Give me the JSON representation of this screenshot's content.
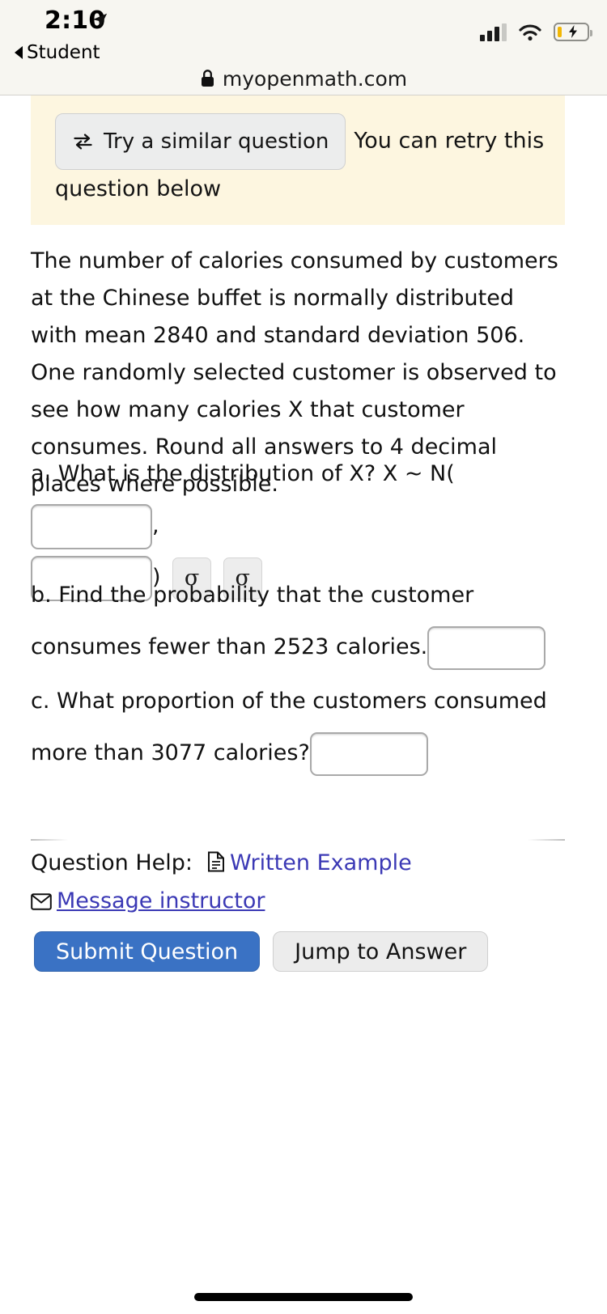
{
  "status_bar": {
    "time": "2:10",
    "location_icon": "location-arrow-icon",
    "back_label": "Student",
    "signal_icon": "cellular-signal-icon",
    "wifi_icon": "wifi-icon",
    "battery_icon": "battery-charging-icon"
  },
  "browser": {
    "lock_icon": "lock-icon",
    "url": "myopenmath.com"
  },
  "banner": {
    "try_similar_label": "Try a similar question",
    "try_similar_icon": "retry-swap-icon",
    "note": "You can retry this question below",
    "background_color": "#fdf6e0"
  },
  "question": {
    "body": "The number of calories consumed by customers at the Chinese buffet is normally distributed with mean 2840 and standard deviation 506. One randomly selected customer is observed to see how many calories X that customer consumes. Round all answers to 4 decimal places where possible.",
    "mean": "2840",
    "std_dev": "506",
    "parts": [
      {
        "id": "a",
        "text_before": "a. What is the distribution of X? X ~ N(",
        "text_mid": ",",
        "text_after": ")",
        "answer_1": "",
        "answer_2": "",
        "symbol_button_1": "σ",
        "symbol_button_2": "σ"
      },
      {
        "id": "b",
        "text": "b. Find the probability that the customer consumes fewer than 2523 calories.",
        "threshold": "2523",
        "answer": ""
      },
      {
        "id": "c",
        "text": "c. What proportion of the customers consumed more than 3077 calories?",
        "threshold": "3077",
        "answer": ""
      }
    ]
  },
  "help": {
    "label": "Question Help:",
    "written_example_label": "Written Example",
    "written_example_icon": "document-icon",
    "message_instructor_label": "Message instructor",
    "message_instructor_icon": "envelope-icon",
    "link_color": "#3b39b5"
  },
  "actions": {
    "submit_label": "Submit Question",
    "jump_label": "Jump to Answer",
    "submit_color": "#3a72c4"
  }
}
